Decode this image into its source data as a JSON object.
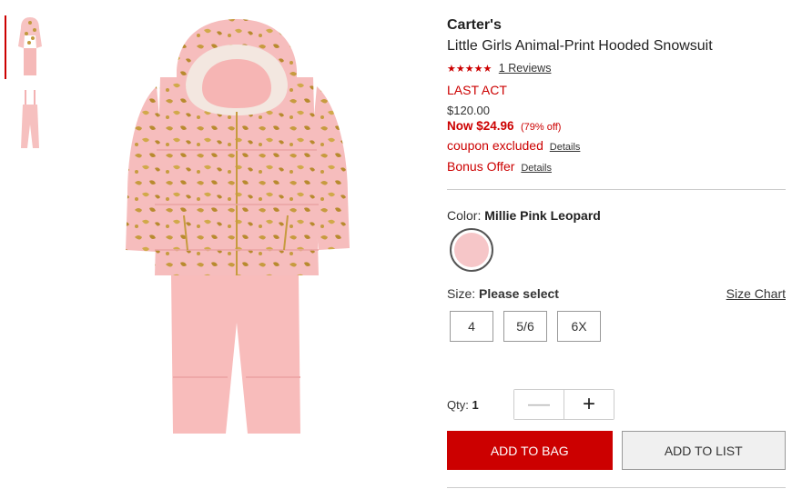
{
  "product": {
    "brand": "Carter's",
    "title": "Little Girls Animal-Print Hooded Snowsuit",
    "rating": {
      "stars": "★★★★★",
      "reviews_label": "1 Reviews"
    },
    "badge": "LAST ACT",
    "original_price": "$120.00",
    "sale_price": "Now $24.96",
    "discount": "(79% off)",
    "promos": [
      {
        "label": "coupon excluded",
        "details": "Details"
      },
      {
        "label": "Bonus Offer",
        "details": "Details"
      }
    ]
  },
  "color": {
    "label": "Color:",
    "selected": "Millie Pink Leopard",
    "swatch_hex": "#f6c6c8"
  },
  "size": {
    "label": "Size:",
    "selected": "Please select",
    "chart_link": "Size Chart",
    "options": [
      "4",
      "5/6",
      "6X"
    ]
  },
  "quantity": {
    "label": "Qty:",
    "value": "1",
    "minus": "—",
    "plus": "+"
  },
  "actions": {
    "add_to_bag": "ADD TO BAG",
    "add_to_list": "ADD TO LIST"
  },
  "colors": {
    "accent": "#cc0000",
    "jacket_pink": "#f4b8b7",
    "leopard_gold": "#b9913d"
  }
}
